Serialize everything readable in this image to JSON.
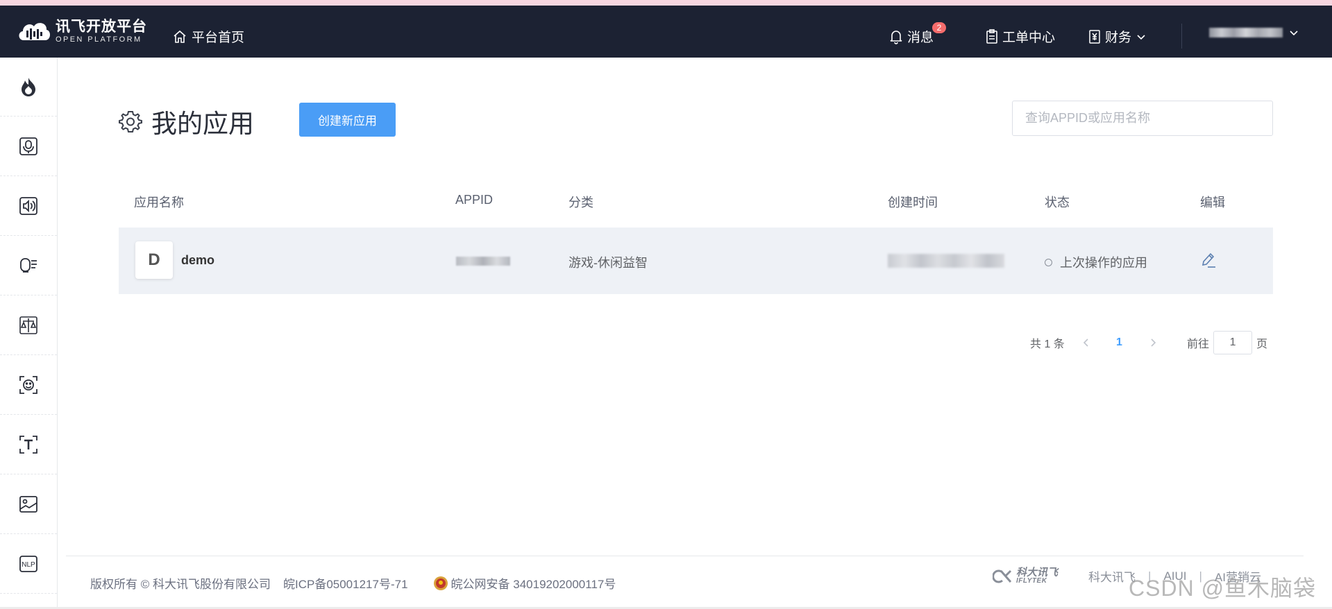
{
  "header": {
    "logo_cn": "讯飞开放平台",
    "logo_en": "OPEN PLATFORM",
    "home_label": "平台首页",
    "messages_label": "消息",
    "messages_badge": "2",
    "workorder_label": "工单中心",
    "finance_label": "财务"
  },
  "sidebar": {
    "items": [
      "flame-icon",
      "voice-recording-icon",
      "speaker-icon",
      "voice-transcribe-icon",
      "compare-icon",
      "face-recognition-icon",
      "text-ocr-icon",
      "image-icon",
      "nlp-icon"
    ],
    "nlp_text": "NLP"
  },
  "main": {
    "title": "我的应用",
    "create_button": "创建新应用",
    "search_placeholder": "查询APPID或应用名称"
  },
  "table": {
    "columns": [
      "应用名称",
      "APPID",
      "分类",
      "创建时间",
      "状态",
      "编辑"
    ],
    "rows": [
      {
        "avatar_letter": "D",
        "name": "demo",
        "category": "游戏-休闲益智",
        "status": "上次操作的应用"
      }
    ]
  },
  "pagination": {
    "total": "共 1 条",
    "current_page": "1",
    "goto_label": "前往",
    "goto_value": "1",
    "page_suffix": "页"
  },
  "footer": {
    "copyright": "版权所有 © 科大讯飞股份有限公司",
    "icp": "皖ICP备05001217号-71",
    "police": "皖公网安备 34019202000117号",
    "brand_cn": "科大讯飞",
    "brand_en": "IFLYTEK",
    "link1": "科大讯飞",
    "link2": "AIUI",
    "link3": "AI营销云",
    "watermark": "CSDN @鱼木脑袋"
  },
  "colors": {
    "header_bg": "#1c2233",
    "primary": "#4a9df6",
    "row_bg": "#eef1f6",
    "badge": "#f56c6c"
  }
}
